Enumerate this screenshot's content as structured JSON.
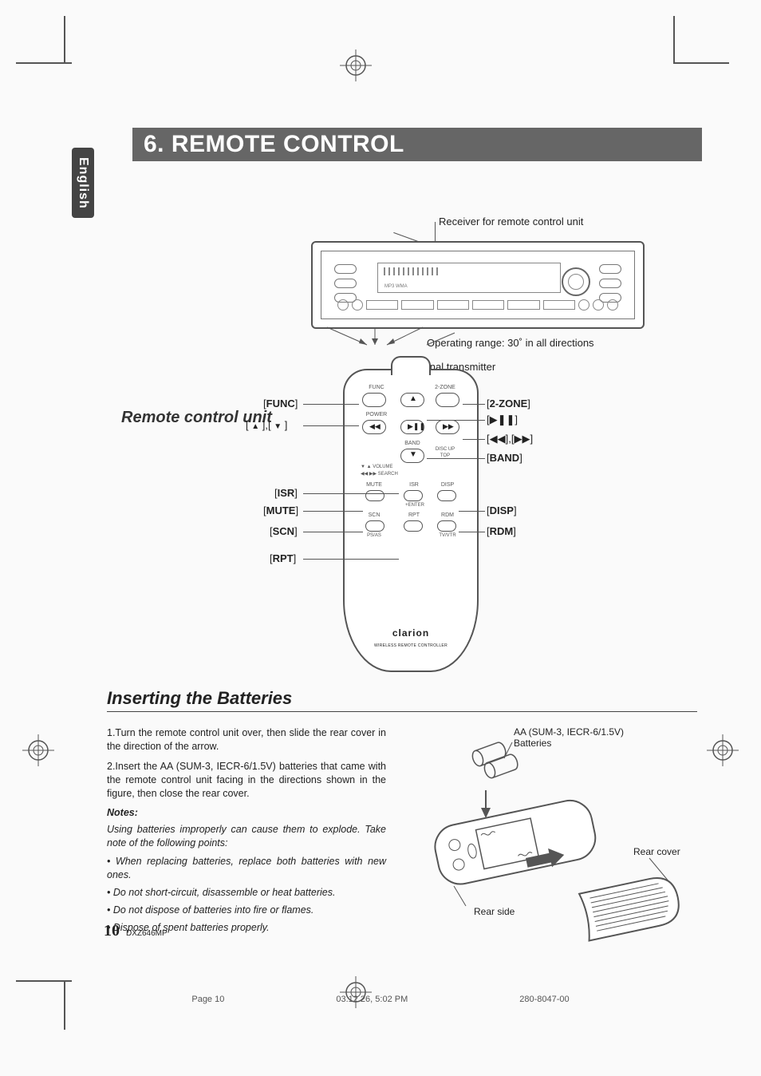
{
  "language_tab": "English",
  "title": "6. REMOTE CONTROL",
  "head_unit": {
    "receiver_label": "Receiver for remote control unit",
    "range_label": "Operating range: 30˚ in all directions",
    "transmitter_label": "Signal transmitter"
  },
  "remote_heading": "Remote control unit",
  "remote_labels": {
    "func": "FUNC",
    "updown_prefix": "[ ",
    "up": "▲",
    "mid1": " ],[ ",
    "down": "▼",
    "updown_suffix": " ]",
    "isr": "ISR",
    "mute": "MUTE",
    "scn": "SCN",
    "rpt": "RPT",
    "two_zone": "2-ZONE",
    "playpause": "[▶❚❚]",
    "seek": "[◀◀],[▶▶]",
    "band": "BAND",
    "disp": "DISP",
    "rdm": "RDM"
  },
  "remote_face": {
    "func": "FUNC",
    "two_zone": "2-ZONE",
    "power": "POWER",
    "band": "BAND",
    "disc_up": "DISC UP",
    "top": "TOP",
    "vol": "▼ ▲ VOLUME",
    "search": "◀◀ ▶▶ SEARCH",
    "mute": "MUTE",
    "isr": "ISR",
    "disp": "DISP",
    "enter": "+ENTER",
    "scn": "SCN",
    "rpt_s": "RPT",
    "rdm": "RDM",
    "psas": "PS/AS",
    "tvvtr": "TV/VTR",
    "brand": "clarion",
    "brand_sub": "WIRELESS REMOTE CONTROLLER"
  },
  "batteries": {
    "heading": "Inserting the Batteries",
    "step1": "1.Turn the remote control unit over, then slide the rear cover in the direction of the arrow.",
    "step2": "2.Insert the AA (SUM-3, IECR-6/1.5V) batteries that came with the remote control unit facing in the directions shown in the figure, then close the rear cover.",
    "notes_h": "Notes:",
    "notes_intro": "Using batteries improperly can cause them to explode. Take note of the following points:",
    "note1": "• When replacing batteries, replace both batteries with new ones.",
    "note2": "• Do not short-circuit, disassemble or heat batteries.",
    "note3": "• Do not dispose of batteries into fire or flames.",
    "note4": "• Dispose of spent batteries properly.",
    "fig_batt": "AA (SUM-3, IECR-6/1.5V) Batteries",
    "fig_rearside": "Rear side",
    "fig_rearcover": "Rear cover"
  },
  "footer": {
    "page_num": "10",
    "model": "DXZ646MP",
    "imprint_page": "Page 10",
    "imprint_date": "03.12.26, 5:02 PM",
    "imprint_code": "280-8047-00"
  }
}
